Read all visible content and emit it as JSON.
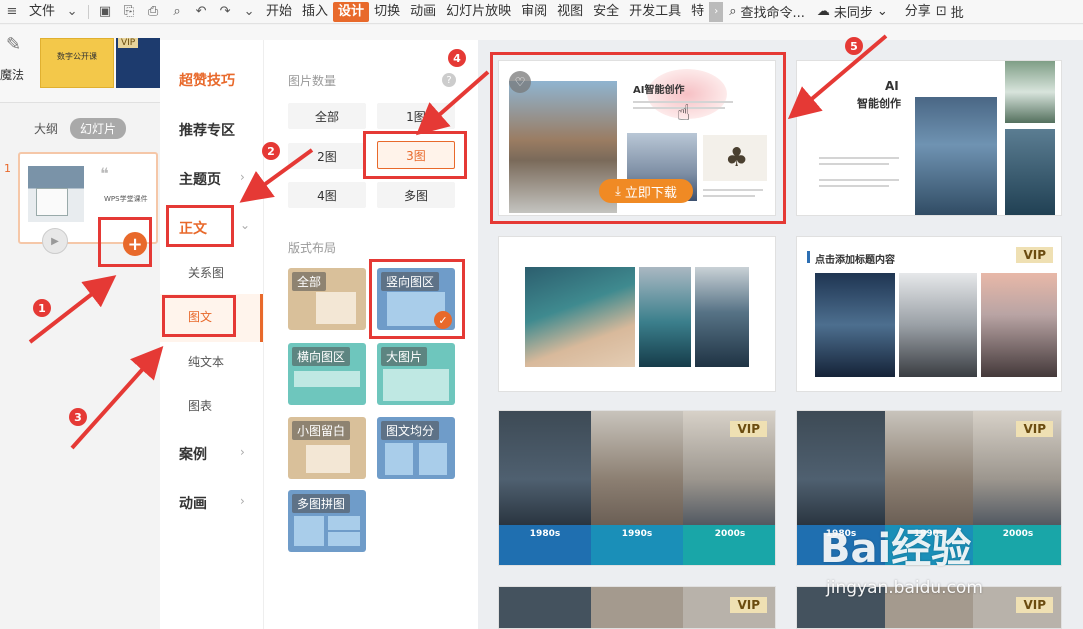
{
  "ribbon": {
    "file_menu": "文件",
    "tabs": [
      "开始",
      "插入",
      "设计",
      "切换",
      "动画",
      "幻灯片放映",
      "审阅",
      "视图",
      "安全",
      "开发工具",
      "特"
    ],
    "active_tab": "设计",
    "search": "查找命令...",
    "sync": "未同步",
    "share": "分享",
    "batch": "批"
  },
  "toolbar": {
    "magic_label": "魔法",
    "thumb1_text": "数字公开课",
    "thumb2_vip": "VIP"
  },
  "slides_pane": {
    "tab_outline": "大纲",
    "tab_slides": "幻灯片",
    "slide_number": "1",
    "slide_title": "WPS学堂课件"
  },
  "categories": {
    "header": "超赞技巧",
    "items": [
      "推荐专区",
      "主题页",
      "正文",
      "关系图",
      "图文",
      "纯文本",
      "图表",
      "案例",
      "动画"
    ]
  },
  "filters": {
    "image_count_heading": "图片数量",
    "image_count_options": [
      "全部",
      "1图",
      "2图",
      "3图",
      "4图",
      "多图"
    ],
    "selected_count": "3图",
    "layout_heading": "版式布局",
    "layouts": [
      "全部",
      "竖向图区",
      "横向图区",
      "大图片",
      "小图留白",
      "图文均分",
      "多图拼图"
    ],
    "selected_layout": "竖向图区"
  },
  "templates": {
    "card1_title": "AI智能创作",
    "card1_download": "立即下载",
    "card2_title_line1": "AI",
    "card2_title_line2": "智能创作",
    "card4_title": "点击添加标题内容",
    "vip_label": "VIP",
    "timeline_years": [
      "1980s",
      "1990s",
      "2000s"
    ]
  },
  "annotations": [
    "1",
    "2",
    "3",
    "4",
    "5"
  ],
  "watermark": {
    "brand": "Bai经验",
    "url": "jingyan.baidu.com"
  },
  "colors": {
    "accent": "#e8692b",
    "highlight_box": "#e53935",
    "download": "#f08a24"
  }
}
